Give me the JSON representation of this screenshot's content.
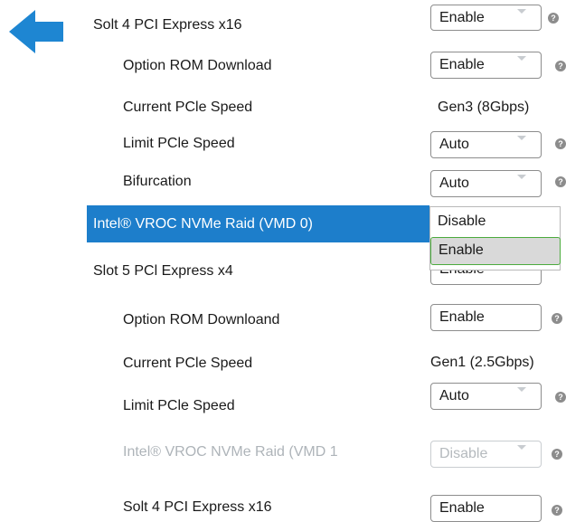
{
  "colors": {
    "accent": "#1d7ecb",
    "option_border": "#4cab3e"
  },
  "back": {
    "icon": "back-arrow-icon"
  },
  "rows": [
    {
      "label": "Solt 4 PCI Express x16",
      "value": "Enable"
    },
    {
      "label": "Option ROM Download",
      "value": "Enable"
    },
    {
      "label": "Current PCle Speed",
      "value": "Gen3 (8Gbps)"
    },
    {
      "label": "Limit PCle Speed",
      "value": "Auto"
    },
    {
      "label": "Bifurcation",
      "value": "Auto"
    },
    {
      "label": "Intel® VROC NVMe Raid (VMD 0)",
      "value": "Enable"
    },
    {
      "label": "Slot 5 PCl Express x4",
      "value": "Enable"
    },
    {
      "label": "Option ROM Downloand",
      "value": "Enable"
    },
    {
      "label": "Current PCle Speed",
      "value": "Gen1 (2.5Gbps)"
    },
    {
      "label": "Limit PCle Speed",
      "value": "Auto"
    },
    {
      "label": "Intel® VROC NVMe Raid (VMD 1",
      "value": "Disable"
    },
    {
      "label": "Solt 4 PCI Express x16",
      "value": "Enable"
    }
  ],
  "dropdown": {
    "options": [
      "Disable",
      "Enable"
    ],
    "selected": "Enable"
  },
  "help_glyph": "?"
}
